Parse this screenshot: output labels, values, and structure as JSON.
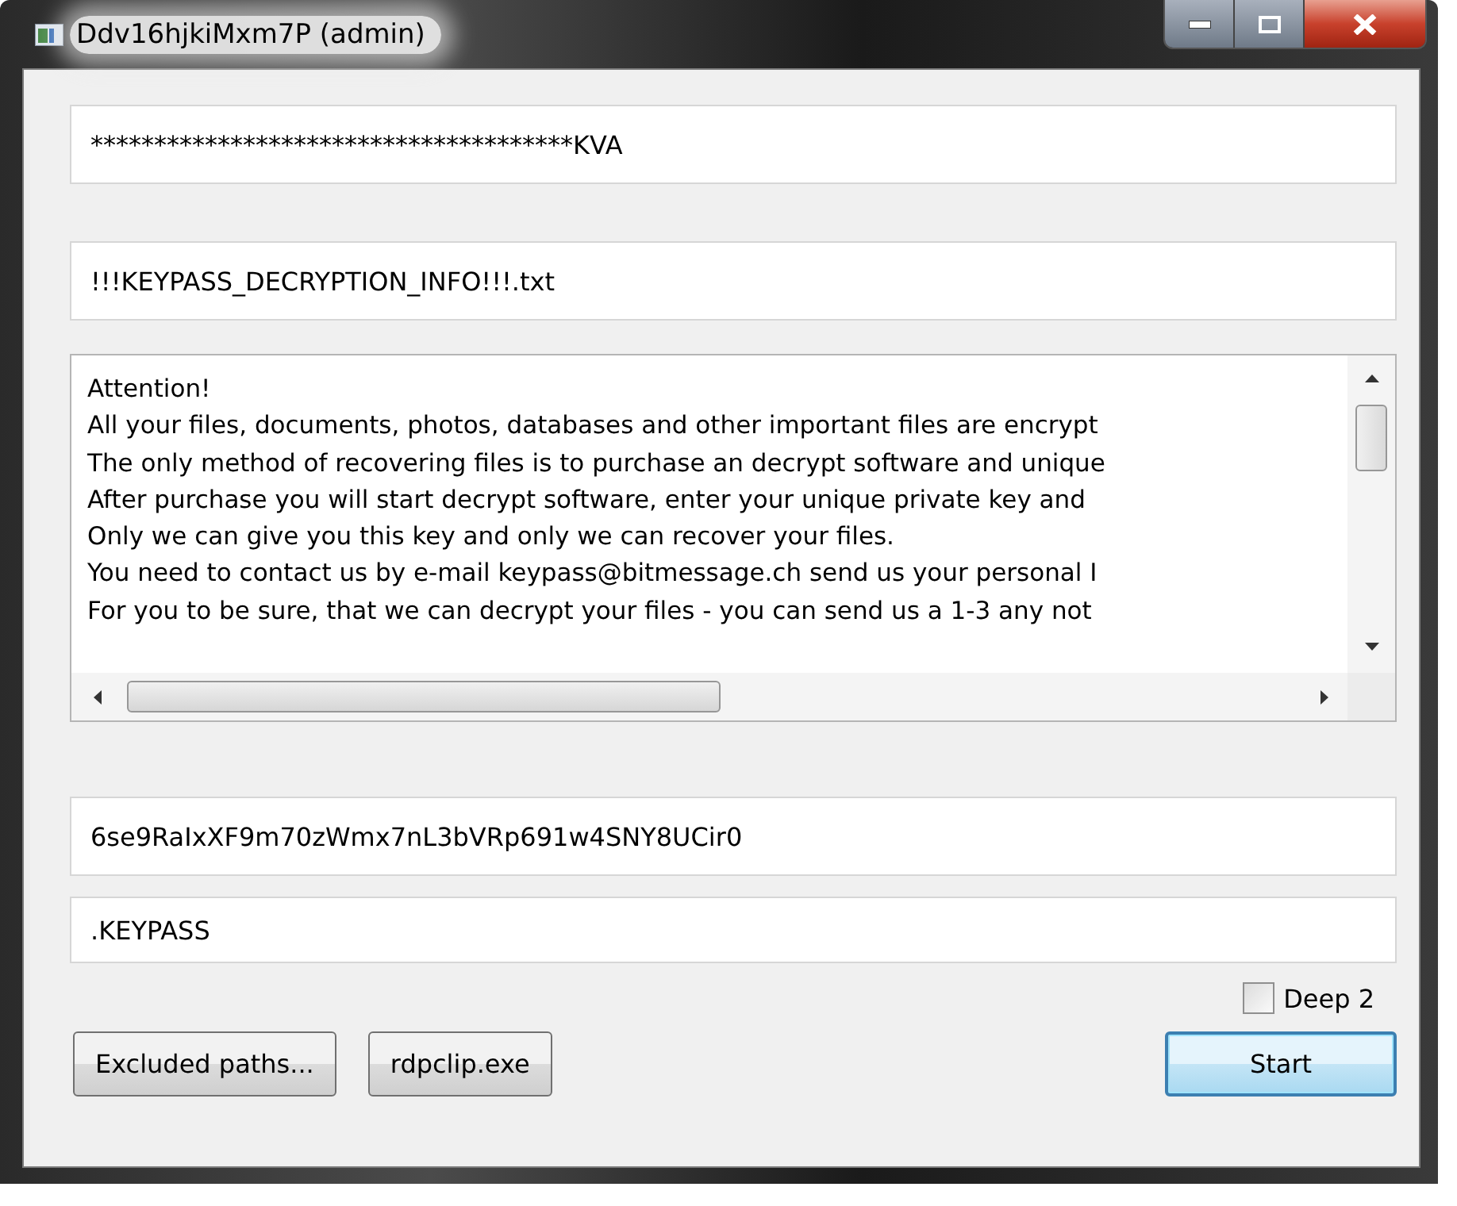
{
  "window": {
    "title": "Ddv16hjkiMxm7P (admin)"
  },
  "top_fields": [
    {
      "value": "**************************************KVA"
    },
    {
      "value": "!!!KEYPASS_DECRYPTION_INFO!!!.txt"
    }
  ],
  "note": {
    "lines": [
      "Attention!",
      "All your files, documents, photos, databases and other important files are encrypt",
      "The only method of recovering files is to purchase an decrypt software and unique",
      "After purchase you will start decrypt software, enter your unique private key and",
      "Only we can give you this key and only we can recover your files.",
      "You need to contact us by e-mail keypass@bitmessage.ch send us your personal I",
      "For you to be sure, that we can decrypt your files - you can send us a 1-3 any not"
    ]
  },
  "bottom_fields": [
    {
      "value": "6se9RaIxXF9m70zWmx7nL3bVRp691w4SNY8UCir0"
    },
    {
      "value": ".KEYPASS"
    }
  ],
  "checkbox": {
    "label": "Deep 2",
    "checked": false
  },
  "buttons": [
    {
      "label": "Excluded paths...",
      "default": false
    },
    {
      "label": "rdpclip.exe",
      "default": false
    },
    {
      "label": "Start",
      "default": true
    }
  ]
}
